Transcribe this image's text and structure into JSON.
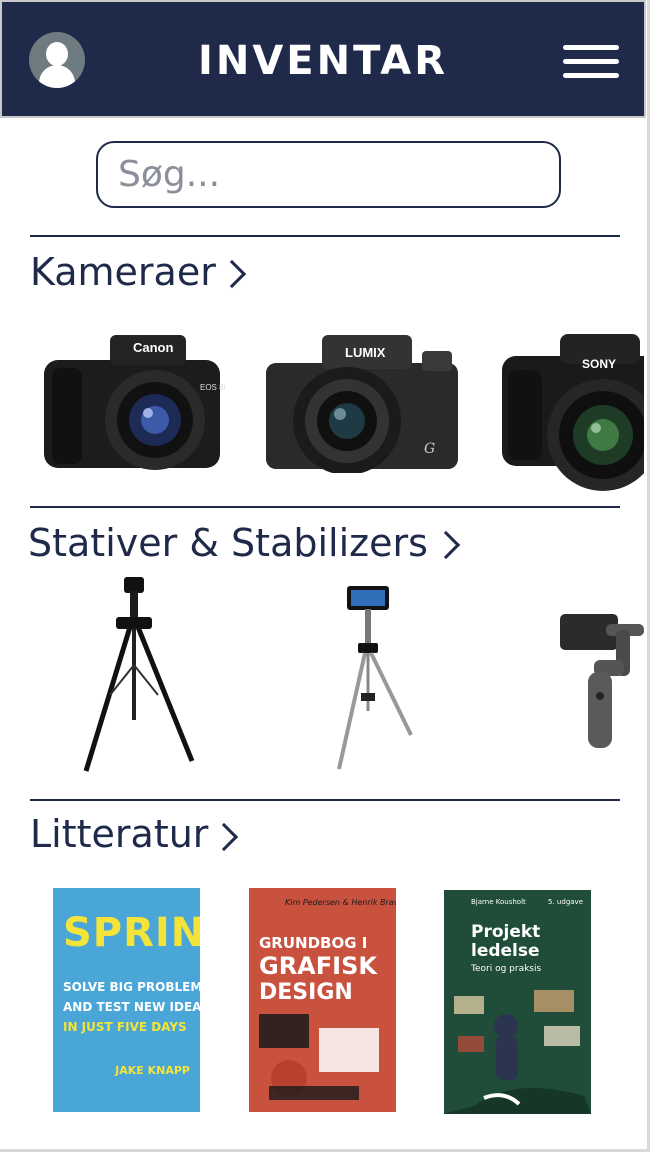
{
  "header": {
    "title": "INVENTAR"
  },
  "search": {
    "placeholder": "Søg..."
  },
  "sections": [
    {
      "title": "Kameraer",
      "items": [
        {
          "brand": "Canon",
          "model": "EOS 80D"
        },
        {
          "brand": "LUMIX",
          "model": "G"
        },
        {
          "brand": "SONY",
          "model": ""
        }
      ]
    },
    {
      "title": "Stativer & Stabilizers",
      "items": [
        {
          "name": "tripod"
        },
        {
          "name": "phone-tripod"
        },
        {
          "name": "gimbal"
        }
      ]
    },
    {
      "title": "Litteratur",
      "items": [
        {
          "line1": "SPRINT",
          "line2": "SOLVE BIG PROBLEMS",
          "line3": "AND TEST NEW IDEAS",
          "line4": "IN JUST FIVE DAYS",
          "author": "JAKE KNAPP",
          "color": "#4aa6d6"
        },
        {
          "authors": "Kim Pedersen & Henrik Bravig",
          "line1": "GRUNDBOG I",
          "line2": "GRAFISK",
          "line3": "DESIGN",
          "color": "#c9523f"
        },
        {
          "author": "Bjarne Kousholt",
          "edition": "5. udgave",
          "line1": "Projekt",
          "line2": "ledelse",
          "line3": "Teori og praksis",
          "color": "#1f4d3a"
        }
      ]
    }
  ],
  "colors": {
    "navy": "#1f2a4a",
    "white": "#ffffff"
  }
}
